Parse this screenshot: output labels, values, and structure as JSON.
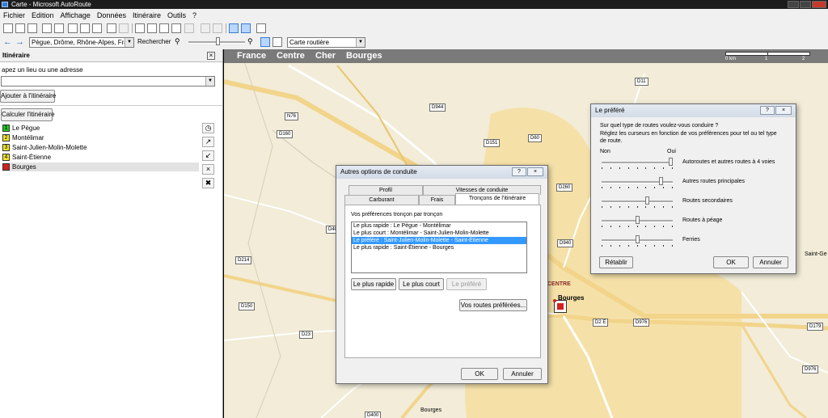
{
  "window": {
    "title": "Carte - Microsoft AutoRoute"
  },
  "menu": [
    "Fichier",
    "Edition",
    "Affichage",
    "Données",
    "Itinéraire",
    "Outils",
    "?"
  ],
  "toolbar2": {
    "location_value": "Pègue, Drôme, Rhône-Alpes, France",
    "search_label": "Rechercher",
    "map_style_value": "Carte routière"
  },
  "left_panel": {
    "title": "Itinéraire",
    "prompt": "apez un lieu ou une adresse",
    "add_button": "Ajouter à l'itinéraire",
    "calc_button": "Calculer l'itinéraire",
    "stops": [
      {
        "num": "1",
        "label": "Le Pègue",
        "color": "#22c322"
      },
      {
        "num": "2",
        "label": "Montélimar",
        "color": "#f5e52a"
      },
      {
        "num": "3",
        "label": "Saint-Julien-Molin-Molette",
        "color": "#f5e52a"
      },
      {
        "num": "4",
        "label": "Saint-Étienne",
        "color": "#f5e52a"
      },
      {
        "num": "",
        "label": "Bourges",
        "color": "#d42020"
      }
    ]
  },
  "map": {
    "breadcrumb": [
      "France",
      "Centre",
      "Cher",
      "Bourges"
    ],
    "scale": {
      "start": "0 km",
      "mid": "1",
      "end": "2"
    },
    "labels": {
      "centre": "CENTRE",
      "bourges": "Bourges",
      "bourges_bottom": "Bourges",
      "saint_ge": "Saint-Ge"
    },
    "roads": [
      "D944",
      "N76",
      "D160",
      "D151",
      "D60",
      "D11",
      "D260",
      "D40",
      "D940",
      "D214",
      "D150",
      "D23",
      "D2 E",
      "D976",
      "D179",
      "D976",
      "D400"
    ]
  },
  "dialog_driving": {
    "title": "Autres options de conduite",
    "help": "?",
    "tabs_row1": [
      "Profil",
      "Vitesses de conduite"
    ],
    "tabs_row2": [
      "Carburant",
      "Frais",
      "Tronçons de l'itinéraire"
    ],
    "group_label": "Vos préférences tronçon par tronçon",
    "segments": [
      "Le plus rapide : Le Pègue - Montélimar",
      "Le plus court : Montélimar - Saint-Julien-Molin-Molette",
      "Le préféré : Saint-Julien-Molin-Molette - Saint-Étienne",
      "Le plus rapide : Saint-Étienne - Bourges"
    ],
    "selected_index": 2,
    "buttons": {
      "fastest": "Le plus rapide",
      "shortest": "Le plus court",
      "preferred": "Le préféré",
      "my_roads": "Vos routes préférées...",
      "ok": "OK",
      "cancel": "Annuler"
    }
  },
  "dialog_preferred": {
    "title": "Le préféré",
    "help": "?",
    "question": "Sur quel type de routes voulez-vous conduire ?",
    "instruction": "Réglez les curseurs en fonction de vos préférences pour tel ou tel type de route.",
    "no_label": "Non",
    "yes_label": "Oui",
    "sliders": [
      {
        "label": "Autoroutes et autres routes à 4 voies",
        "value": 1.0
      },
      {
        "label": "Autres routes principales",
        "value": 0.85
      },
      {
        "label": "Routes secondaires",
        "value": 0.65
      },
      {
        "label": "Routes à péage",
        "value": 0.5
      },
      {
        "label": "Ferries",
        "value": 0.5
      }
    ],
    "buttons": {
      "reset": "Rétablir",
      "ok": "OK",
      "cancel": "Annuler"
    }
  }
}
